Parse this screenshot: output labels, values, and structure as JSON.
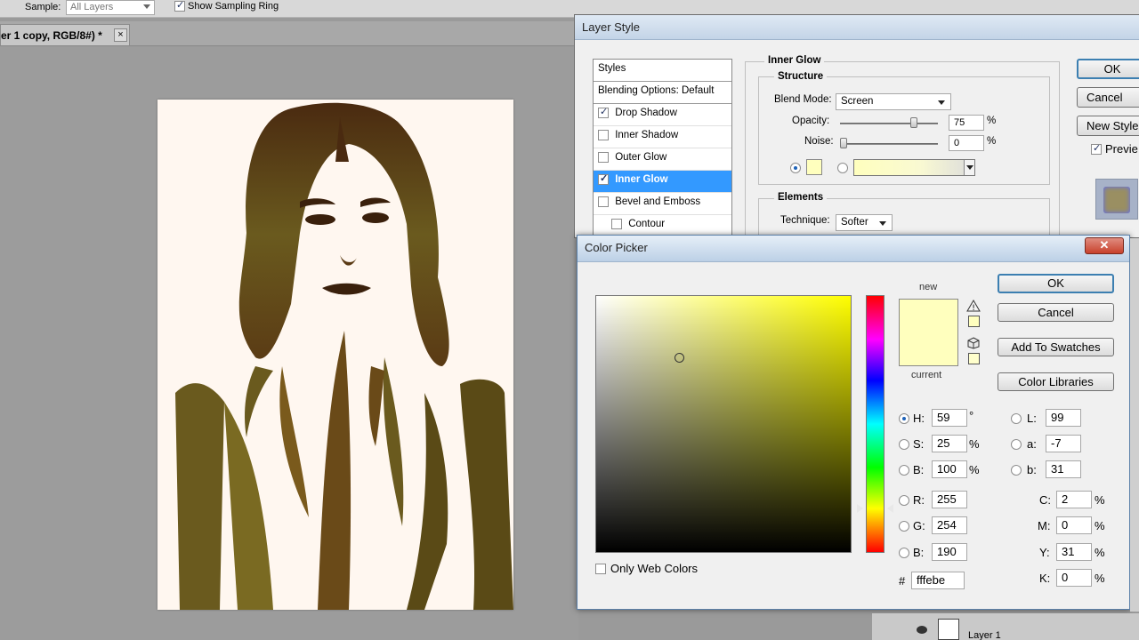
{
  "options_bar": {
    "sample_label": "Sample:",
    "sample_value": "All Layers",
    "show_sampling_ring_label": "Show Sampling Ring",
    "show_sampling_ring_checked": true
  },
  "document_tab": {
    "title": "er 1 copy, RGB/8#) *",
    "close": "×"
  },
  "layer_style": {
    "title": "Layer Style",
    "styles_list": [
      {
        "label": "Styles",
        "type": "header"
      },
      {
        "label": "Blending Options: Default",
        "type": "header"
      },
      {
        "label": "Drop Shadow",
        "checked": true
      },
      {
        "label": "Inner Shadow",
        "checked": false
      },
      {
        "label": "Outer Glow",
        "checked": false
      },
      {
        "label": "Inner Glow",
        "checked": true,
        "selected": true
      },
      {
        "label": "Bevel and Emboss",
        "checked": false
      },
      {
        "label": "Contour",
        "checked": false,
        "indent": true
      }
    ],
    "section_title": "Inner Glow",
    "structure_label": "Structure",
    "blend_mode_label": "Blend Mode:",
    "blend_mode_value": "Screen",
    "opacity_label": "Opacity:",
    "opacity_value": "75",
    "opacity_percent": 75,
    "noise_label": "Noise:",
    "noise_value": "0",
    "noise_percent": 0,
    "percent": "%",
    "elements_label": "Elements",
    "technique_label": "Technique:",
    "technique_value": "Softer",
    "ok_label": "OK",
    "cancel_label": "Cancel",
    "new_style_label": "New Style",
    "preview_label": "Previe",
    "preview_checked": true,
    "glow_color": "#ffffbe"
  },
  "color_picker": {
    "title": "Color Picker",
    "close": "✕",
    "new_label": "new",
    "current_label": "current",
    "ok_label": "OK",
    "cancel_label": "Cancel",
    "add_to_swatches_label": "Add To Swatches",
    "color_libraries_label": "Color Libraries",
    "only_web_colors_label": "Only Web Colors",
    "only_web_colors_checked": false,
    "fields": {
      "H": {
        "label": "H:",
        "value": "59",
        "unit": "°",
        "selected": true
      },
      "S": {
        "label": "S:",
        "value": "25",
        "unit": "%"
      },
      "B": {
        "label": "B:",
        "value": "100",
        "unit": "%"
      },
      "R": {
        "label": "R:",
        "value": "255"
      },
      "G": {
        "label": "G:",
        "value": "254"
      },
      "Bl": {
        "label": "B:",
        "value": "190"
      },
      "L": {
        "label": "L:",
        "value": "99"
      },
      "a": {
        "label": "a:",
        "value": "-7"
      },
      "b": {
        "label": "b:",
        "value": "31"
      },
      "C": {
        "label": "C:",
        "value": "2",
        "unit": "%"
      },
      "M": {
        "label": "M:",
        "value": "0",
        "unit": "%"
      },
      "Y": {
        "label": "Y:",
        "value": "31",
        "unit": "%"
      },
      "K": {
        "label": "K:",
        "value": "0",
        "unit": "%"
      }
    },
    "hash": "#",
    "hex_value": "fffebe",
    "new_color": "#ffffbe",
    "current_color": "#ffffbe"
  },
  "layers_panel": {
    "layer_name": "Layer 1"
  }
}
